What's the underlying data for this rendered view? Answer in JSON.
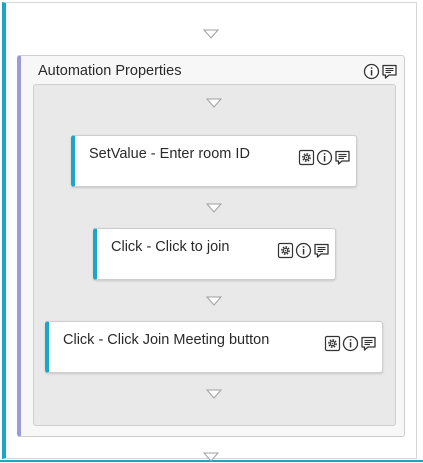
{
  "container": {
    "title": "Automation Properties",
    "icons": [
      "info-icon",
      "annotation-icon"
    ]
  },
  "activities": [
    {
      "label": "SetValue - Enter room ID",
      "icons": [
        "properties-icon",
        "info-icon",
        "annotation-icon"
      ]
    },
    {
      "label": "Click - Click to join",
      "icons": [
        "properties-icon",
        "info-icon",
        "annotation-icon"
      ]
    },
    {
      "label": "Click - Click Join Meeting button",
      "icons": [
        "properties-icon",
        "info-icon",
        "annotation-icon"
      ]
    }
  ],
  "colors": {
    "accent": "#1aa6c4",
    "sequence_border": "#9b9bdb",
    "inner_background": "#e9e9e9"
  }
}
